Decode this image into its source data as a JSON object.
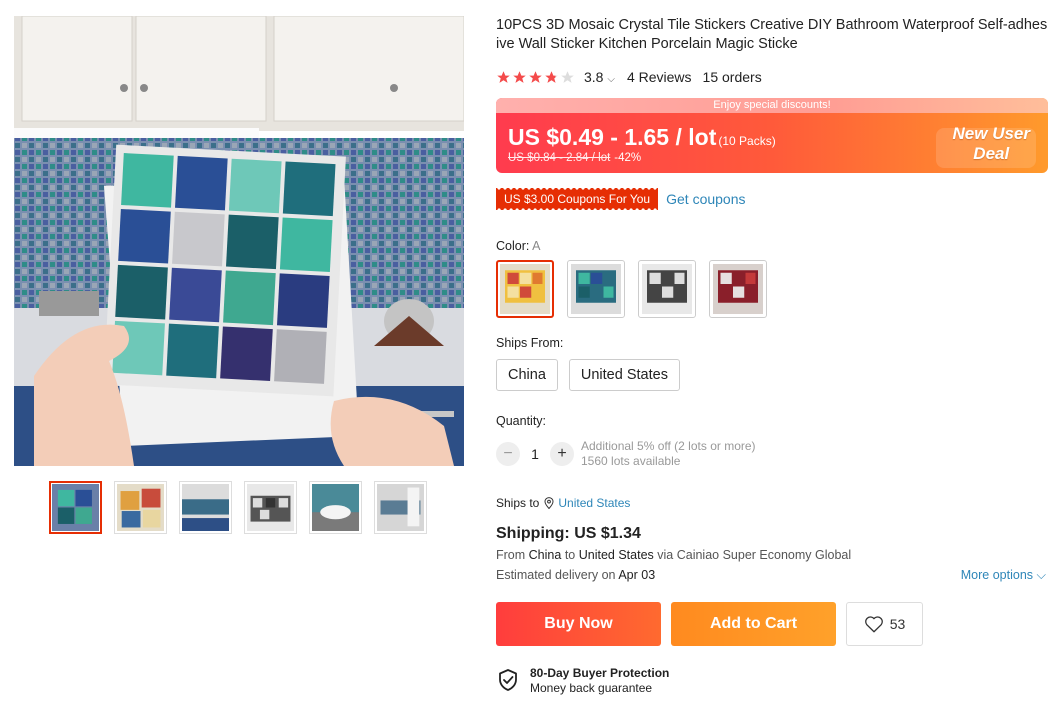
{
  "product": {
    "title": "10PCS 3D Mosaic Crystal Tile Stickers Creative DIY Bathroom Waterproof Self-adhesive Wall Sticker Kitchen Porcelain Magic Sticke",
    "rating_value": "3.8",
    "rating_stars": 3.8,
    "reviews": "4 Reviews",
    "orders": "15 orders"
  },
  "price": {
    "banner": "Enjoy special discounts!",
    "range": "US $0.49 - 1.65 / lot",
    "packs": "(10 Packs)",
    "old_range": "US $0.84 - 2.84 / lot",
    "discount": "-42%",
    "deal_line1": "New User",
    "deal_line2": "Deal"
  },
  "coupon": {
    "label": "US $3.00 Coupons For You",
    "link": "Get coupons"
  },
  "color": {
    "label": "Color:",
    "selected": "A"
  },
  "ships_from": {
    "label": "Ships From:",
    "options": [
      "China",
      "United States"
    ]
  },
  "quantity": {
    "label": "Quantity:",
    "minus": "−",
    "value": "1",
    "plus": "+",
    "note_line1": "Additional 5% off (2 lots or more)",
    "note_line2": "1560 lots available"
  },
  "ships_to": {
    "label": "Ships to",
    "country": "United States"
  },
  "shipping": {
    "price": "Shipping: US $1.34",
    "from_prefix": "From",
    "from": "China",
    "to_prefix": "to",
    "to": "United States",
    "via": "via Cainiao Super Economy Global",
    "est_prefix": "Estimated delivery on",
    "est_date": "Apr 03",
    "more_options": "More options"
  },
  "actions": {
    "buy": "Buy Now",
    "cart": "Add to Cart",
    "wish_count": "53"
  },
  "protection": {
    "title": "80-Day Buyer Protection",
    "subtitle": "Money back guarantee"
  },
  "colors": {
    "accent": "#e62e04",
    "link": "#2e86b8",
    "star": "#f44b4b"
  }
}
